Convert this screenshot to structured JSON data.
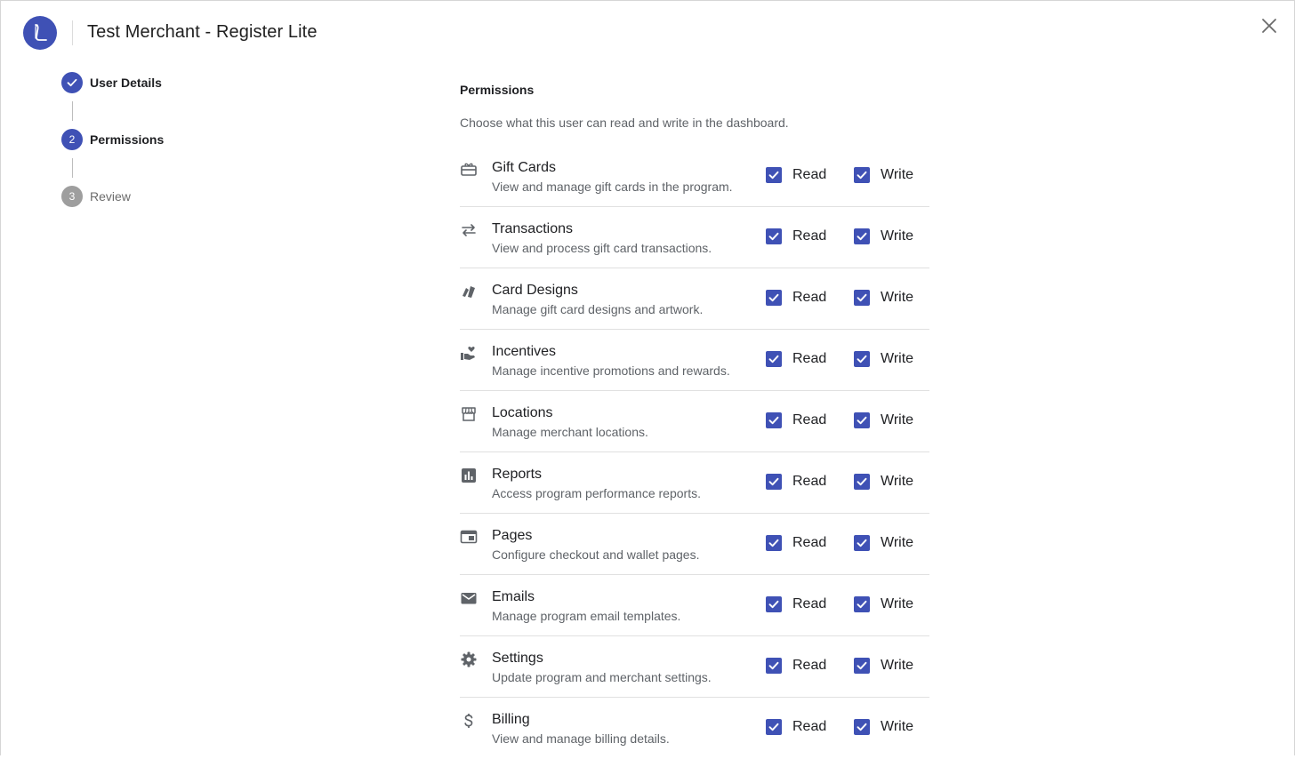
{
  "header": {
    "title": "Test Merchant - Register Lite",
    "logo_icon": "logo-l-icon",
    "close_icon": "close-icon"
  },
  "stepper": {
    "steps": [
      {
        "number": "",
        "label": "User Details",
        "state": "complete"
      },
      {
        "number": "2",
        "label": "Permissions",
        "state": "active"
      },
      {
        "number": "3",
        "label": "Review",
        "state": "pending"
      }
    ]
  },
  "main": {
    "title": "Permissions",
    "description": "Choose what this user can read and write in the dashboard."
  },
  "colors": {
    "primary": "#3f51b5",
    "pending_step": "#9e9e9e",
    "divider": "#e0e0e0"
  },
  "permissions": [
    {
      "icon": "gift-card-icon",
      "name": "Gift Cards",
      "desc": "View and manage gift cards in the program.",
      "read_label": "Read",
      "write_label": "Write",
      "read": true,
      "write": true
    },
    {
      "icon": "transfer-arrows-icon",
      "name": "Transactions",
      "desc": "View and process gift card transactions.",
      "read_label": "Read",
      "write_label": "Write",
      "read": true,
      "write": true
    },
    {
      "icon": "cards-stack-icon",
      "name": "Card Designs",
      "desc": "Manage gift card designs and artwork.",
      "read_label": "Read",
      "write_label": "Write",
      "read": true,
      "write": true
    },
    {
      "icon": "hand-heart-icon",
      "name": "Incentives",
      "desc": "Manage incentive promotions and rewards.",
      "read_label": "Read",
      "write_label": "Write",
      "read": true,
      "write": true
    },
    {
      "icon": "storefront-icon",
      "name": "Locations",
      "desc": "Manage merchant locations.",
      "read_label": "Read",
      "write_label": "Write",
      "read": true,
      "write": true
    },
    {
      "icon": "bar-chart-icon",
      "name": "Reports",
      "desc": "Access program performance reports.",
      "read_label": "Read",
      "write_label": "Write",
      "read": true,
      "write": true
    },
    {
      "icon": "web-page-icon",
      "name": "Pages",
      "desc": "Configure checkout and wallet pages.",
      "read_label": "Read",
      "write_label": "Write",
      "read": true,
      "write": true
    },
    {
      "icon": "mail-icon",
      "name": "Emails",
      "desc": "Manage program email templates.",
      "read_label": "Read",
      "write_label": "Write",
      "read": true,
      "write": true
    },
    {
      "icon": "gear-icon",
      "name": "Settings",
      "desc": "Update program and merchant settings.",
      "read_label": "Read",
      "write_label": "Write",
      "read": true,
      "write": true
    },
    {
      "icon": "dollar-icon",
      "name": "Billing",
      "desc": "View and manage billing details.",
      "read_label": "Read",
      "write_label": "Write",
      "read": true,
      "write": true
    }
  ]
}
